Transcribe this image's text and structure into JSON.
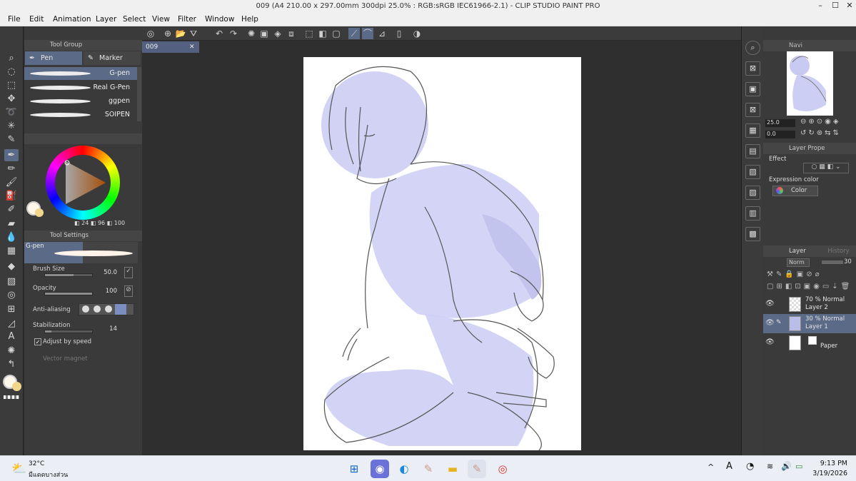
{
  "window": {
    "title": "009 (A4 210.00 x 297.00mm 300dpi 25.0% : RGB:sRGB IEC61966-2.1)  - CLIP STUDIO PAINT PRO"
  },
  "menu": [
    "File",
    "Edit",
    "Animation",
    "Layer",
    "Select",
    "View",
    "Filter",
    "Window",
    "Help"
  ],
  "tool_group": {
    "header": "Tool Group",
    "tabs": [
      "Pen",
      "Marker"
    ],
    "brushes": [
      "G-pen",
      "Real G-Pen",
      "ggpen",
      "SOIPEN"
    ]
  },
  "color": {
    "readout": [
      "24",
      "96",
      "100"
    ],
    "accent": "#5b6a86"
  },
  "tool_settings": {
    "header": "Tool Settings",
    "brush_name": "G-pen",
    "brush_size_label": "Brush Size",
    "brush_size_value": "50.0",
    "opacity_label": "Opacity",
    "opacity_value": "100",
    "antialiasing_label": "Anti-aliasing",
    "stabilization_label": "Stabilization",
    "stabilization_value": "14",
    "adjust_by_speed": "Adjust by speed",
    "vector_magnet": "Vector magnet"
  },
  "document_tab": "009",
  "navigator": {
    "header": "Navi",
    "zoom": "25.0",
    "rotation": "0.0"
  },
  "layer_property": {
    "header": "Layer Prope",
    "effect": "Effect",
    "expression_color_label": "Expression color",
    "expression_color_value": "Color"
  },
  "layers_panel": {
    "tab_layer": "Layer",
    "tab_history": "History",
    "blend_mode": "Norm",
    "opacity": "30",
    "layers": [
      {
        "info": "70 % Normal",
        "name": "Layer 2"
      },
      {
        "info": "30 % Normal",
        "name": "Layer 1"
      },
      {
        "info": "",
        "name": "Paper"
      }
    ]
  },
  "taskbar": {
    "temperature": "32°C",
    "weather": "มีแดดบางส่วน",
    "time": "9:13 PM",
    "date": "3/19/2026"
  }
}
